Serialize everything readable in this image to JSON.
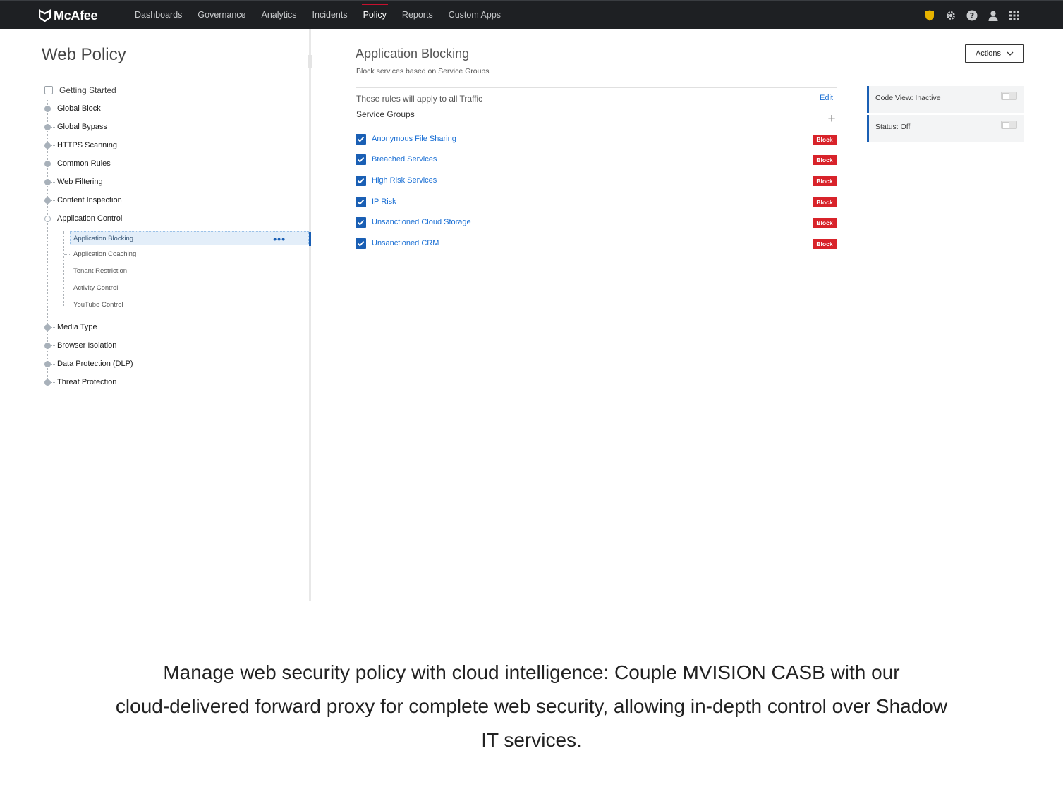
{
  "brand": {
    "name": "McAfee"
  },
  "nav": {
    "items": [
      {
        "label": "Dashboards",
        "active": false
      },
      {
        "label": "Governance",
        "active": false
      },
      {
        "label": "Analytics",
        "active": false
      },
      {
        "label": "Incidents",
        "active": false
      },
      {
        "label": "Policy",
        "active": true
      },
      {
        "label": "Reports",
        "active": false
      },
      {
        "label": "Custom Apps",
        "active": false
      }
    ],
    "icons": [
      "shield-badge-icon",
      "gear-icon",
      "help-icon",
      "user-icon",
      "apps-grid-icon"
    ]
  },
  "left": {
    "title": "Web Policy",
    "getting_started": "Getting Started",
    "items": [
      "Global Block",
      "Global Bypass",
      "HTTPS Scanning",
      "Common Rules",
      "Web Filtering",
      "Content Inspection",
      "Application Control"
    ],
    "sub_items": [
      "Application Blocking",
      "Application Coaching",
      "Tenant Restriction",
      "Activity Control",
      "YouTube Control"
    ],
    "more_options": "•••",
    "items_after": [
      "Media Type",
      "Browser Isolation",
      "Data Protection (DLP)",
      "Threat Protection"
    ]
  },
  "main": {
    "title": "Application Blocking",
    "subtitle": "Block services based on Service Groups",
    "actions_label": "Actions",
    "rules_text": "These rules will apply to all Traffic",
    "edit_label": "Edit",
    "service_groups_label": "Service Groups",
    "add_symbol": "+",
    "services": [
      {
        "name": "Anonymous File Sharing",
        "action": "Block",
        "checked": true
      },
      {
        "name": "Breached Services",
        "action": "Block",
        "checked": true
      },
      {
        "name": "High Risk Services",
        "action": "Block",
        "checked": true
      },
      {
        "name": "IP Risk",
        "action": "Block",
        "checked": true
      },
      {
        "name": "Unsanctioned Cloud Storage",
        "action": "Block",
        "checked": true
      },
      {
        "name": "Unsanctioned CRM",
        "action": "Block",
        "checked": true
      }
    ]
  },
  "right": {
    "code_view": "Code View: Inactive",
    "status": "Status: Off"
  },
  "caption": {
    "line1": "Manage web security policy with cloud intelligence: Couple MVISION CASB with our",
    "line2": "cloud-delivered forward proxy for complete web security, allowing in-depth control over Shadow",
    "line3": "IT services."
  },
  "colors": {
    "topbar": "#1e2023",
    "accent_blue": "#1a5fb4",
    "link_blue": "#1a6fd4",
    "block_red": "#d8232a",
    "nav_active_red": "#c8102e",
    "shield_yellow": "#e8b400"
  }
}
